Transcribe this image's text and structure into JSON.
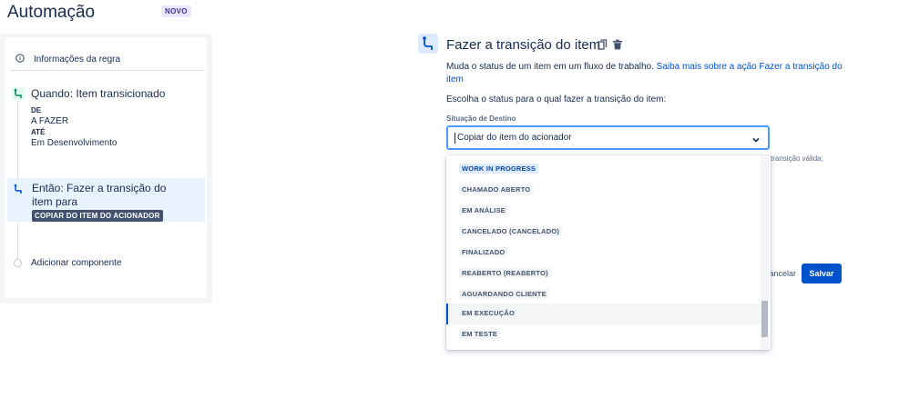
{
  "header": {
    "title": "Automação",
    "badge": "NOVO"
  },
  "rule_panel": {
    "info_label": "Informações da regra",
    "trigger": {
      "label": "Quando: Item transicionado",
      "from_key": "DE",
      "from_value": "A FAZER",
      "to_key": "ATÉ",
      "to_value": "Em Desenvolvimento"
    },
    "action": {
      "label": "Então: Fazer a transição do item para",
      "pill": "COPIAR DO ITEM DO ACIONADOR"
    },
    "add_component": "Adicionar componente"
  },
  "main": {
    "title": "Fazer a transição do item",
    "description": "Muda o status de um item em um fluxo de trabalho.",
    "learn_more": "Saiba mais sobre a ação Fazer a transição do item",
    "choose_label": "Escolha o status para o qual fazer a transição do item:",
    "destination_label": "Situação de Destino",
    "select_value": "Copiar do item do acionador",
    "hint_text": "transição válida;",
    "cancel_label": "Cancelar",
    "save_label": "Salvar"
  },
  "dropdown": {
    "options": [
      "WORK IN PROGRESS",
      "CHAMADO ABERTO",
      "EM ANÁLISE",
      "CANCELADO (CANCELADO)",
      "FINALIZADO",
      "REABERTO (REABERTO)",
      "AGUARDANDO CLIENTE",
      "EM EXECUÇÃO",
      "EM TESTE"
    ],
    "selected": "EM EXECUÇÃO"
  },
  "colors": {
    "accent": "#0052cc",
    "link": "#0052cc",
    "badge_bg": "#eae6ff",
    "badge_text": "#403294"
  },
  "icons": {
    "info": "info-icon",
    "trigger": "transition-icon",
    "action": "transition-icon",
    "copy": "copy-icon",
    "delete": "trash-icon",
    "chevron": "chevron-down-icon"
  }
}
